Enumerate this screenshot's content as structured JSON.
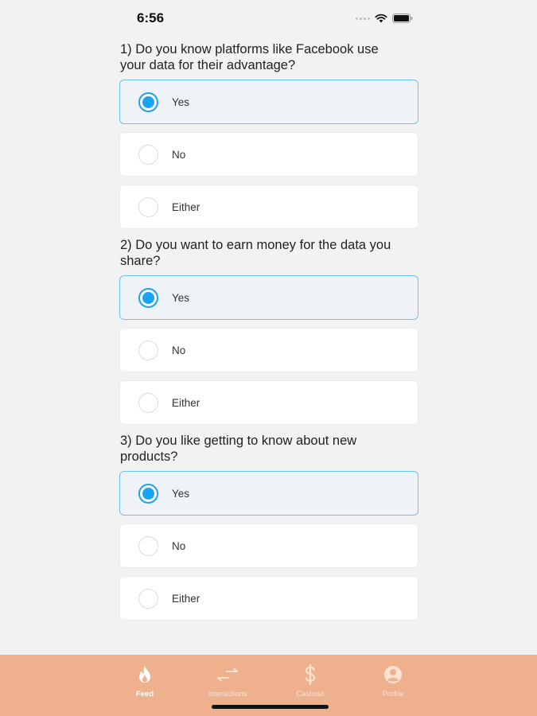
{
  "status_bar": {
    "time": "6:56"
  },
  "questions": [
    {
      "text": "1) Do you know platforms like Facebook use\nyour data for their advantage?",
      "options": [
        {
          "label": "Yes",
          "selected": true
        },
        {
          "label": "No",
          "selected": false
        },
        {
          "label": "Either",
          "selected": false
        }
      ]
    },
    {
      "text": "2) Do you want to earn money for the data you\nshare?",
      "options": [
        {
          "label": "Yes",
          "selected": true
        },
        {
          "label": "No",
          "selected": false
        },
        {
          "label": "Either",
          "selected": false
        }
      ]
    },
    {
      "text": "3) Do you like getting to know about new\nproducts?",
      "options": [
        {
          "label": "Yes",
          "selected": true
        },
        {
          "label": "No",
          "selected": false
        },
        {
          "label": "Either",
          "selected": false
        }
      ]
    }
  ],
  "tab_bar": {
    "tabs": [
      {
        "label": "Feed",
        "icon": "flame-icon",
        "active": true
      },
      {
        "label": "Interactions",
        "icon": "arrows-exchange-icon",
        "active": false
      },
      {
        "label": "Cashout",
        "icon": "dollar-icon",
        "active": false
      },
      {
        "label": "Profile",
        "icon": "user-circle-icon",
        "active": false
      }
    ]
  },
  "colors": {
    "accent": "#1aa3f0",
    "selected_border": "#6ec2f4",
    "tab_bar_bg": "#efb08d",
    "background": "#f2f2f2"
  }
}
